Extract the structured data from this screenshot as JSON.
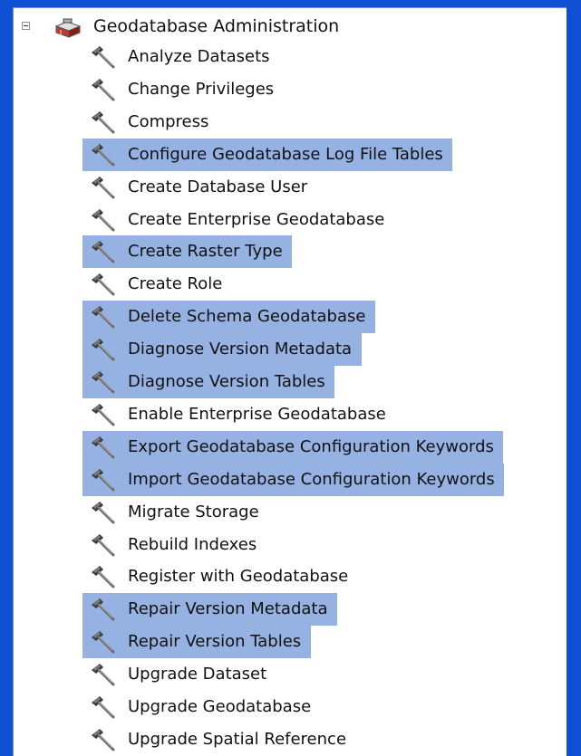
{
  "tree": {
    "root": {
      "label": "Geodatabase Administration",
      "expanded": true,
      "expander_icon": "minus-box-icon",
      "icon": "toolbox-icon"
    },
    "item_icon": "hammer-tool-icon",
    "selection_color": "#96b2e3",
    "background_color": "#0f4fd4",
    "items": [
      {
        "label": "Analyze Datasets",
        "selected": false
      },
      {
        "label": "Change Privileges",
        "selected": false
      },
      {
        "label": "Compress",
        "selected": false
      },
      {
        "label": "Configure Geodatabase Log File Tables",
        "selected": true
      },
      {
        "label": "Create Database User",
        "selected": false
      },
      {
        "label": "Create Enterprise Geodatabase",
        "selected": false
      },
      {
        "label": "Create Raster Type",
        "selected": true
      },
      {
        "label": "Create Role",
        "selected": false
      },
      {
        "label": "Delete Schema Geodatabase",
        "selected": true
      },
      {
        "label": "Diagnose Version Metadata",
        "selected": true
      },
      {
        "label": "Diagnose Version Tables",
        "selected": true
      },
      {
        "label": "Enable Enterprise Geodatabase",
        "selected": false
      },
      {
        "label": "Export Geodatabase Configuration Keywords",
        "selected": true
      },
      {
        "label": "Import Geodatabase Configuration Keywords",
        "selected": true
      },
      {
        "label": "Migrate Storage",
        "selected": false
      },
      {
        "label": "Rebuild Indexes",
        "selected": false
      },
      {
        "label": "Register with Geodatabase",
        "selected": false
      },
      {
        "label": "Repair Version Metadata",
        "selected": true
      },
      {
        "label": "Repair Version Tables",
        "selected": true
      },
      {
        "label": "Upgrade Dataset",
        "selected": false
      },
      {
        "label": "Upgrade Geodatabase",
        "selected": false
      },
      {
        "label": "Upgrade Spatial Reference",
        "selected": false
      }
    ]
  }
}
